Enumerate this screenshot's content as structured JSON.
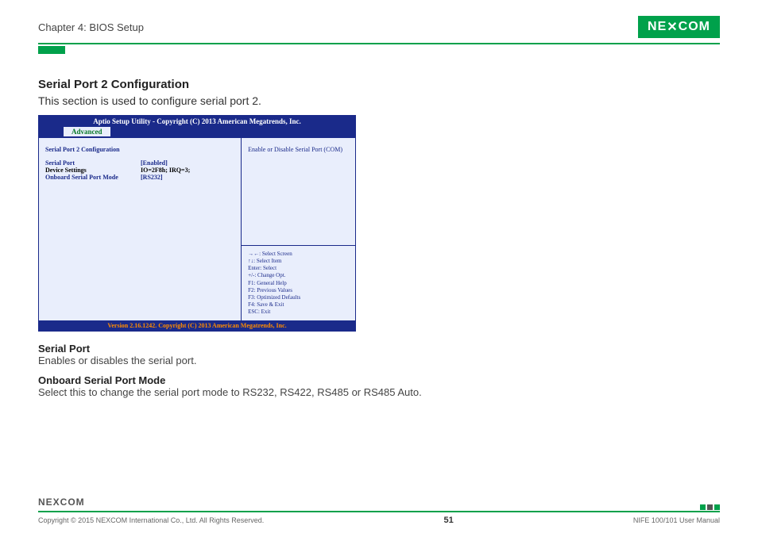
{
  "header": {
    "chapter": "Chapter 4: BIOS Setup",
    "logo_text": "NE COM",
    "logo_x": "X"
  },
  "section": {
    "title": "Serial Port 2 Configuration",
    "description": "This section is used to configure serial port 2."
  },
  "bios": {
    "title": "Aptio Setup Utility - Copyright (C) 2013 American Megatrends, Inc.",
    "tab": "Advanced",
    "heading": "Serial Port 2 Configuration",
    "rows": [
      {
        "label": "Serial Port",
        "label_color": "blue",
        "value": "[Enabled]",
        "value_color": "blue"
      },
      {
        "label": "Device Settings",
        "label_color": "black",
        "value": "IO=2F8h; IRQ=3;",
        "value_color": "black"
      },
      {
        "label": "Onboard Serial Port Mode",
        "label_color": "blue",
        "value": "[RS232]",
        "value_color": "blue"
      }
    ],
    "help": "Enable or Disable Serial Port (COM)",
    "keys": [
      "→←: Select Screen",
      "↑↓: Select Item",
      "Enter: Select",
      "+/-: Change Opt.",
      "F1: General Help",
      "F2: Previous Values",
      "F3: Optimized Defaults",
      "F4: Save & Exit",
      "ESC: Exit"
    ],
    "footer": "Version 2.16.1242. Copyright (C) 2013 American Megatrends, Inc."
  },
  "descriptions": [
    {
      "heading": "Serial Port",
      "body": "Enables or disables the serial port."
    },
    {
      "heading": "Onboard Serial Port Mode",
      "body": "Select this to change the serial port mode to RS232, RS422, RS485 or RS485 Auto."
    }
  ],
  "footer": {
    "logo": "NEXCOM",
    "copyright": "Copyright © 2015 NEXCOM International Co., Ltd. All Rights Reserved.",
    "page": "51",
    "manual": "NIFE 100/101 User Manual"
  }
}
